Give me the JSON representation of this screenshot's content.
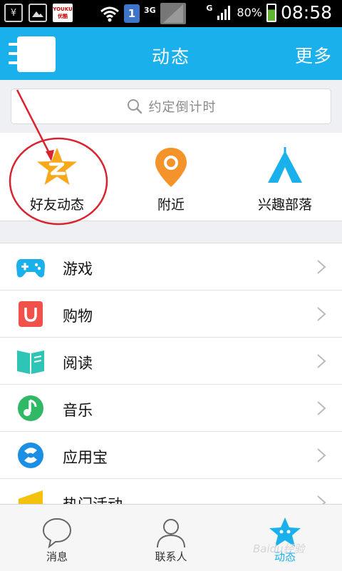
{
  "status_bar": {
    "youku_label": "YOUKU 优酷",
    "sim_badge": "1",
    "network_3g": "3G",
    "network_g": "G",
    "battery_percent": "80%",
    "time": "08:58"
  },
  "header": {
    "title": "动态",
    "more_label": "更多"
  },
  "search": {
    "placeholder": "约定倒计时"
  },
  "quick_tiles": [
    {
      "label": "好友动态",
      "icon": "qzone-star-icon"
    },
    {
      "label": "附近",
      "icon": "location-pin-icon"
    },
    {
      "label": "兴趣部落",
      "icon": "tribe-tent-icon"
    }
  ],
  "list_items": [
    {
      "label": "游戏",
      "icon": "gamepad-icon"
    },
    {
      "label": "购物",
      "icon": "shopping-bag-icon"
    },
    {
      "label": "阅读",
      "icon": "book-icon"
    },
    {
      "label": "音乐",
      "icon": "music-note-icon"
    },
    {
      "label": "应用宝",
      "icon": "app-store-icon"
    },
    {
      "label": "热门活动",
      "icon": "megaphone-icon"
    }
  ],
  "tabs": [
    {
      "label": "消息",
      "icon": "chat-bubble-icon"
    },
    {
      "label": "联系人",
      "icon": "contact-person-icon"
    },
    {
      "label": "动态",
      "icon": "star-dynamic-icon",
      "active": true
    }
  ],
  "watermark": "Baidu经验",
  "colors": {
    "accent": "#1ab0ec",
    "star_orange": "#f7a81b",
    "pin_orange": "#f5932b",
    "annotation_red": "#d9242f"
  }
}
